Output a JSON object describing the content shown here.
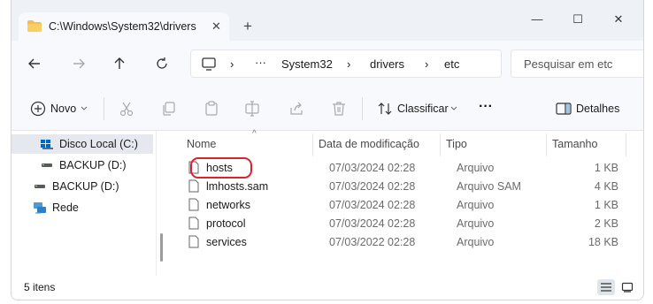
{
  "tab": {
    "title": "C:\\Windows\\System32\\drivers",
    "close": "✕",
    "new": "+"
  },
  "window_controls": {
    "minimize": "—",
    "maximize": "☐",
    "close": "✕"
  },
  "address": {
    "ellipsis": "···",
    "sep": "›",
    "crumbs": [
      "System32",
      "drivers",
      "etc"
    ]
  },
  "search": {
    "placeholder": "Pesquisar em etc"
  },
  "toolbar": {
    "new_label": "Novo",
    "sort_label": "Classificar",
    "more": "···",
    "details_label": "Detalhes"
  },
  "sidebar": {
    "items": [
      {
        "label": "Disco Local (C:)",
        "icon": "windows-drive-icon"
      },
      {
        "label": "BACKUP (D:)",
        "icon": "drive-icon"
      },
      {
        "label": "BACKUP (D:)",
        "icon": "drive-icon"
      },
      {
        "label": "Rede",
        "icon": "network-icon"
      }
    ]
  },
  "columns": {
    "name": "Nome",
    "date": "Data de modificação",
    "type": "Tipo",
    "size": "Tamanho",
    "sort_indicator": "^"
  },
  "files": [
    {
      "name": "hosts",
      "date": "07/03/2024 02:28",
      "type": "Arquivo",
      "size": "1 KB"
    },
    {
      "name": "lmhosts.sam",
      "date": "07/03/2024 02:28",
      "type": "Arquivo SAM",
      "size": "4 KB"
    },
    {
      "name": "networks",
      "date": "07/03/2024 02:28",
      "type": "Arquivo",
      "size": "1 KB"
    },
    {
      "name": "protocol",
      "date": "07/03/2024 02:28",
      "type": "Arquivo",
      "size": "2 KB"
    },
    {
      "name": "services",
      "date": "07/03/2022 02:28",
      "type": "Arquivo",
      "size": "18 KB"
    }
  ],
  "status": {
    "count": "5 itens"
  },
  "colors": {
    "highlight": "#d9232d",
    "folder": "#f3c04f",
    "accent": "#0067c0"
  }
}
